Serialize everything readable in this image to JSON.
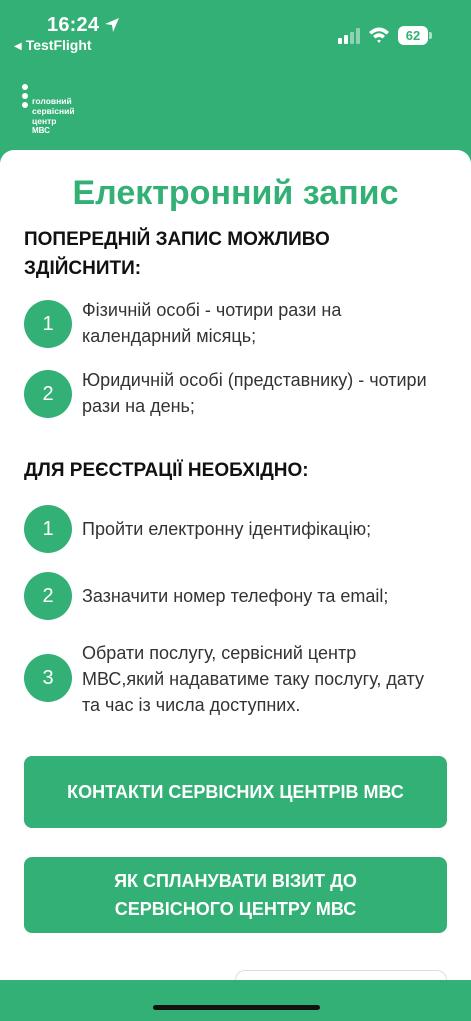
{
  "status": {
    "time": "16:24",
    "back_label": "TestFlight",
    "battery": "62"
  },
  "logo": {
    "line1": "головний",
    "line2": "сервісний",
    "line3": "центр",
    "line4": "МВС"
  },
  "page": {
    "title": "Електронний запис"
  },
  "section1": {
    "heading": "ПОПЕРЕДНІЙ ЗАПИС МОЖЛИВО ЗДІЙСНИТИ:",
    "items": [
      {
        "num": "1",
        "text": "Фізичній особі  - чотири рази на календарний місяць;"
      },
      {
        "num": "2",
        "text": "Юридичній особі (представнику) - чотири рази на день;"
      }
    ]
  },
  "section2": {
    "heading": "ДЛЯ РЕЄСТРАЦІЇ НЕОБХІДНО:",
    "items": [
      {
        "num": "1",
        "text": "Пройти електронну ідентифікацію;"
      },
      {
        "num": "2",
        "text": "Зазначити номер телефону та email;"
      },
      {
        "num": "3",
        "text": "Обрати послугу, сервісний центр МВС,який надаватиме таку послугу, дату та час із числа доступних."
      }
    ]
  },
  "buttons": {
    "contacts": "КОНТАКТИ СЕРВІСНИХ ЦЕНТРІВ МВС",
    "plan_visit": "ЯК СПЛАНУВАТИ ВІЗИТ ДО СЕРВІСНОГО ЦЕНТРУ МВС"
  },
  "colors": {
    "brand_green": "#33b075"
  }
}
